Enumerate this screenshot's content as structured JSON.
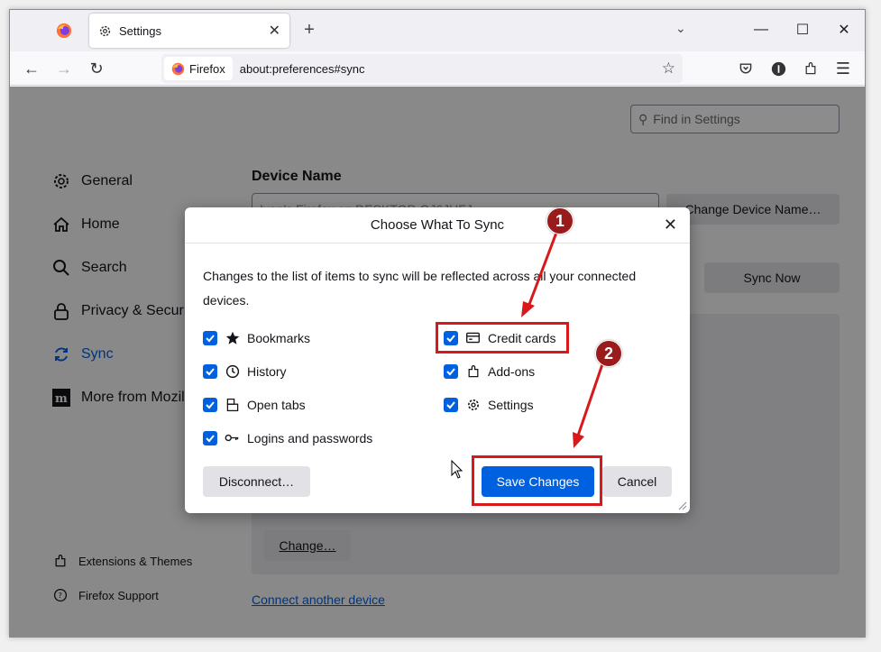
{
  "browser": {
    "tab_title": "Settings",
    "url_identity": "Firefox",
    "url": "about:preferences#sync"
  },
  "settings": {
    "search_placeholder": "Find in Settings",
    "sidebar": [
      {
        "label": "General",
        "icon": "gear-icon"
      },
      {
        "label": "Home",
        "icon": "home-icon"
      },
      {
        "label": "Search",
        "icon": "search-icon"
      },
      {
        "label": "Privacy & Security",
        "icon": "lock-icon"
      },
      {
        "label": "Sync",
        "icon": "sync-icon",
        "active": true
      },
      {
        "label": "More from Mozilla",
        "icon": "mozilla-icon"
      }
    ],
    "footer_links": [
      {
        "label": "Extensions & Themes",
        "icon": "puzzle-icon"
      },
      {
        "label": "Firefox Support",
        "icon": "help-icon"
      }
    ],
    "device_name_heading": "Device Name",
    "device_name_value": "Ivan's Firefox on DESKTOP-QJ6JHFJ",
    "change_device_button": "Change Device Name…",
    "sync_now_button": "Sync Now",
    "change_button": "Change…",
    "connect_link": "Connect another device"
  },
  "dialog": {
    "title": "Choose What To Sync",
    "description": "Changes to the list of items to sync will be reflected across all your connected devices.",
    "options_left": [
      {
        "label": "Bookmarks",
        "icon": "star-icon",
        "checked": true
      },
      {
        "label": "History",
        "icon": "clock-icon",
        "checked": true
      },
      {
        "label": "Open tabs",
        "icon": "tabs-icon",
        "checked": true
      },
      {
        "label": "Logins and passwords",
        "icon": "key-icon",
        "checked": true
      }
    ],
    "options_right": [
      {
        "label": "Credit cards",
        "icon": "credit-card-icon",
        "checked": true
      },
      {
        "label": "Add-ons",
        "icon": "puzzle-icon",
        "checked": true
      },
      {
        "label": "Settings",
        "icon": "gear-icon",
        "checked": true
      }
    ],
    "disconnect_button": "Disconnect…",
    "save_button": "Save Changes",
    "cancel_button": "Cancel"
  },
  "annotations": {
    "badge_1": "1",
    "badge_2": "2",
    "color": "#d7191c"
  },
  "colors": {
    "accent": "#0061e0",
    "badge": "#9a1b1b"
  }
}
